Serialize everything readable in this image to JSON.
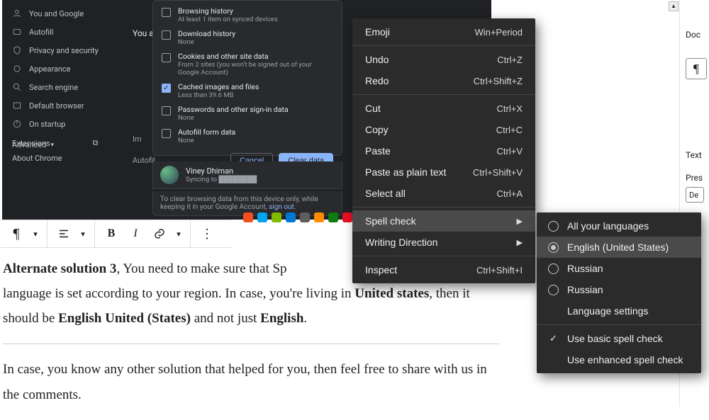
{
  "chrome": {
    "sidebar": [
      {
        "label": "You and Google",
        "icon": "user"
      },
      {
        "label": "Autofill",
        "icon": "autofill"
      },
      {
        "label": "Privacy and security",
        "icon": "shield"
      },
      {
        "label": "Appearance",
        "icon": "appearance"
      },
      {
        "label": "Search engine",
        "icon": "search"
      },
      {
        "label": "Default browser",
        "icon": "browser"
      },
      {
        "label": "On startup",
        "icon": "startup"
      }
    ],
    "advanced": "Advanced",
    "extensions": "Extensions",
    "about": "About Chrome",
    "you_text": "You a",
    "dialog": [
      {
        "checked": false,
        "title": "Browsing history",
        "sub": "At least 1 item on synced devices"
      },
      {
        "checked": false,
        "title": "Download history",
        "sub": "None"
      },
      {
        "checked": false,
        "title": "Cookies and other site data",
        "sub": "From 2 sites (you won't be signed out of your Google Account)"
      },
      {
        "checked": true,
        "title": "Cached images and files",
        "sub": "Less than 39.6 MB"
      },
      {
        "checked": false,
        "title": "Passwords and other sign-in data",
        "sub": "None"
      },
      {
        "checked": false,
        "title": "Autofill form data",
        "sub": "None"
      }
    ],
    "cancel": "Cancel",
    "clear": "Clear data",
    "user_name": "Viney Dhiman",
    "user_sync": "Syncing to ",
    "foot_pre": "To clear browsing data from this device only, while keeping it in your Google Account, ",
    "foot_link": "sign out",
    "im": "Im",
    "autofil": "Autofil"
  },
  "toolbar": {
    "pilcrow": "¶",
    "align": "≡",
    "bold": "B",
    "italic": "I",
    "link": "🔗",
    "more": "⋮",
    "caret": "▾"
  },
  "article": {
    "p1_a": "Alternate solution 3",
    "p1_b": ", You need to make sure that Sp",
    "p1_c": "language is set according to your region. In case, you're living in ",
    "p1_d": "United states",
    "p1_e": ", then it should be ",
    "p1_f": "English United (States)",
    "p1_g": " and not just ",
    "p1_h": "English",
    "p1_i": ".",
    "p2": "In case, you know any other solution that helped for you, then feel free to share with us in the comments."
  },
  "right": {
    "doc": "Doc",
    "text": "Text",
    "pres": "Pres",
    "dd": "De",
    "pil": "¶"
  },
  "ctx": {
    "emoji": {
      "l": "Emoji",
      "k": "Win+Period"
    },
    "undo": {
      "l": "Undo",
      "k": "Ctrl+Z"
    },
    "redo": {
      "l": "Redo",
      "k": "Ctrl+Shift+Z"
    },
    "cut": {
      "l": "Cut",
      "k": "Ctrl+X"
    },
    "copy": {
      "l": "Copy",
      "k": "Ctrl+C"
    },
    "paste": {
      "l": "Paste",
      "k": "Ctrl+V"
    },
    "pasteplain": {
      "l": "Paste as plain text",
      "k": "Ctrl+Shift+V"
    },
    "selectall": {
      "l": "Select all",
      "k": "Ctrl+A"
    },
    "spell": {
      "l": "Spell check"
    },
    "writedir": {
      "l": "Writing Direction"
    },
    "inspect": {
      "l": "Inspect",
      "k": "Ctrl+Shift+I"
    }
  },
  "spell_sub": [
    {
      "type": "radio",
      "sel": false,
      "label": "All your languages"
    },
    {
      "type": "radio",
      "sel": true,
      "label": "English (United States)"
    },
    {
      "type": "radio",
      "sel": false,
      "label": "Russian"
    },
    {
      "type": "radio",
      "sel": false,
      "label": "Russian"
    },
    {
      "type": "plain",
      "label": "Language settings"
    },
    {
      "type": "sep"
    },
    {
      "type": "check",
      "sel": true,
      "label": "Use basic spell check"
    },
    {
      "type": "check",
      "sel": false,
      "label": "Use enhanced spell check"
    }
  ]
}
